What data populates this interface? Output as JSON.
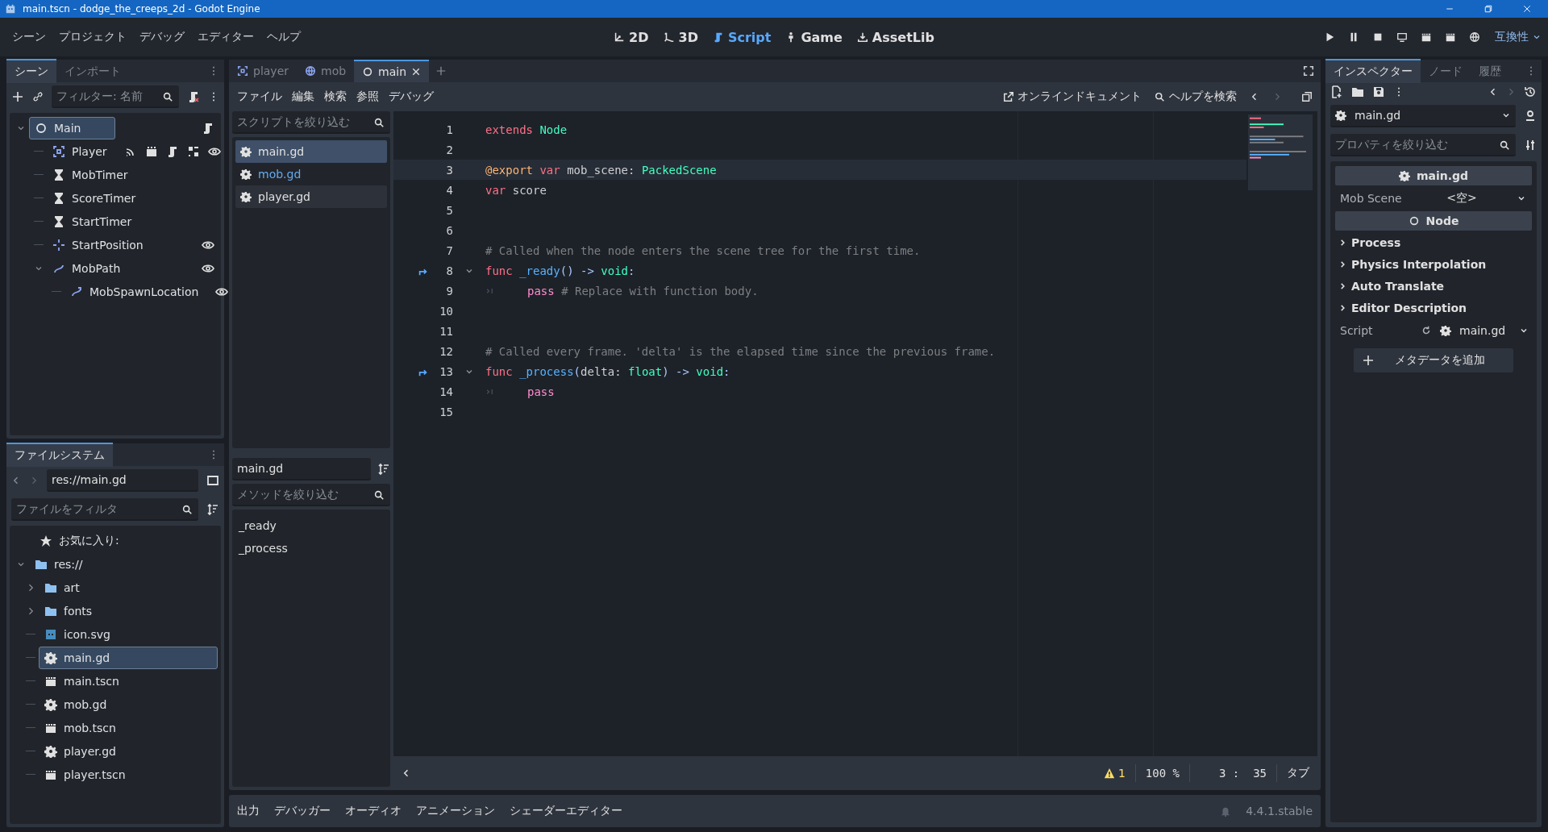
{
  "window": {
    "title": "main.tscn - dodge_the_creeps_2d - Godot Engine"
  },
  "menu": [
    "シーン",
    "プロジェクト",
    "デバッグ",
    "エディター",
    "ヘルプ"
  ],
  "workspaces": [
    {
      "label": "2D",
      "kind": "planar",
      "selected": false
    },
    {
      "label": "3D",
      "kind": "spatial",
      "selected": false
    },
    {
      "label": "Script",
      "kind": "script",
      "selected": true
    },
    {
      "label": "Game",
      "kind": "game",
      "selected": false
    },
    {
      "label": "AssetLib",
      "kind": "assetlib",
      "selected": false
    }
  ],
  "renderer": "互換性",
  "scene_dock": {
    "tabs": [
      {
        "label": "シーン",
        "selected": true
      },
      {
        "label": "インポート",
        "selected": false
      }
    ],
    "filter": {
      "placeholder": "フィルター: 名前"
    },
    "tree": [
      {
        "name": "Main",
        "kind": "node",
        "selected": true,
        "expanded": true,
        "has_script": true,
        "children": [
          {
            "name": "Player",
            "kind": "area",
            "selected": false,
            "signals": true,
            "groups": true,
            "has_script": true,
            "canvas": true,
            "visible": true
          },
          {
            "name": "MobTimer",
            "kind": "timer",
            "selected": false
          },
          {
            "name": "ScoreTimer",
            "kind": "timer",
            "selected": false
          },
          {
            "name": "StartTimer",
            "kind": "timer",
            "selected": false
          },
          {
            "name": "StartPosition",
            "kind": "marker",
            "selected": false,
            "visible": true
          },
          {
            "name": "MobPath",
            "kind": "path",
            "selected": false,
            "expanded": true,
            "visible": true,
            "children": [
              {
                "name": "MobSpawnLocation",
                "kind": "pathfollow",
                "selected": false,
                "visible": true
              }
            ]
          }
        ]
      }
    ]
  },
  "filesystem": {
    "tabs": [
      {
        "label": "ファイルシステム",
        "selected": true
      }
    ],
    "path": "res://main.gd",
    "filter": {
      "placeholder": "ファイルをフィルタ"
    },
    "favorites": "お気に入り:",
    "tree": [
      {
        "name": "res://",
        "kind": "folder",
        "selected": false,
        "expanded": true,
        "children": [
          {
            "name": "art",
            "kind": "folder",
            "selected": false,
            "expanded": false
          },
          {
            "name": "fonts",
            "kind": "folder",
            "selected": false,
            "expanded": false
          },
          {
            "name": "icon.svg",
            "kind": "image",
            "selected": false
          },
          {
            "name": "main.gd",
            "kind": "script",
            "selected": true
          },
          {
            "name": "main.tscn",
            "kind": "scene",
            "selected": false
          },
          {
            "name": "mob.gd",
            "kind": "script",
            "selected": false
          },
          {
            "name": "mob.tscn",
            "kind": "scene",
            "selected": false
          },
          {
            "name": "player.gd",
            "kind": "script",
            "selected": false
          },
          {
            "name": "player.tscn",
            "kind": "scene",
            "selected": false
          }
        ]
      }
    ]
  },
  "editor_tabs": [
    {
      "label": "player",
      "kind": "area",
      "selected": false
    },
    {
      "label": "mob",
      "kind": "globe",
      "selected": false
    },
    {
      "label": "main",
      "kind": "node",
      "selected": true
    }
  ],
  "script_menu": [
    "ファイル",
    "編集",
    "検索",
    "参照",
    "デバッグ"
  ],
  "script_links": [
    {
      "label": "オンラインドキュメント",
      "kind": "external"
    },
    {
      "label": "ヘルプを検索",
      "kind": "help"
    }
  ],
  "scripts": {
    "filter": {
      "placeholder": "スクリプトを絞り込む"
    },
    "items": [
      {
        "name": "main.gd",
        "selected": true,
        "in_scene": false,
        "hovered": false
      },
      {
        "name": "mob.gd",
        "selected": false,
        "in_scene": true,
        "hovered": false
      },
      {
        "name": "player.gd",
        "selected": false,
        "in_scene": false,
        "hovered": true
      }
    ],
    "current": "main.gd",
    "method_filter": {
      "placeholder": "メソッドを絞り込む"
    },
    "methods": [
      "_ready",
      "_process"
    ]
  },
  "code": [
    {
      "number": "1",
      "current": false,
      "foldable": false,
      "connected": false,
      "indented": false,
      "tokens": [
        {
          "kind": "kw",
          "text": "extends "
        },
        {
          "kind": "type",
          "text": "Node"
        }
      ]
    },
    {
      "number": "2",
      "current": false,
      "foldable": false,
      "connected": false,
      "indented": false
    },
    {
      "number": "3",
      "current": true,
      "foldable": false,
      "connected": false,
      "indented": false,
      "tokens": [
        {
          "kind": "anno",
          "text": "@export "
        },
        {
          "kind": "kw",
          "text": "var "
        },
        {
          "kind": "plain",
          "text": "mob_scene: "
        },
        {
          "kind": "type",
          "text": "PackedScene"
        }
      ]
    },
    {
      "number": "4",
      "current": false,
      "foldable": false,
      "connected": false,
      "indented": false,
      "tokens": [
        {
          "kind": "kw",
          "text": "var "
        },
        {
          "kind": "plain",
          "text": "score"
        }
      ]
    },
    {
      "number": "5",
      "current": false,
      "foldable": false,
      "connected": false,
      "indented": false
    },
    {
      "number": "6",
      "current": false,
      "foldable": false,
      "connected": false,
      "indented": false
    },
    {
      "number": "7",
      "current": false,
      "foldable": false,
      "connected": false,
      "indented": false,
      "tokens": [
        {
          "kind": "comment",
          "text": "# Called when the node enters the scene tree for the first time."
        }
      ]
    },
    {
      "number": "8",
      "current": false,
      "foldable": true,
      "connected": true,
      "indented": false,
      "tokens": [
        {
          "kind": "kw",
          "text": "func "
        },
        {
          "kind": "func",
          "text": "_ready"
        },
        {
          "kind": "sym",
          "text": "() -> "
        },
        {
          "kind": "type",
          "text": "void"
        },
        {
          "kind": "sym",
          "text": ":"
        }
      ]
    },
    {
      "number": "9",
      "current": false,
      "foldable": false,
      "connected": false,
      "indented": true,
      "tokens": [
        {
          "kind": "ctrl",
          "text": "pass "
        },
        {
          "kind": "comment",
          "text": "# Replace with function body."
        }
      ]
    },
    {
      "number": "10",
      "current": false,
      "foldable": false,
      "connected": false,
      "indented": false
    },
    {
      "number": "11",
      "current": false,
      "foldable": false,
      "connected": false,
      "indented": false
    },
    {
      "number": "12",
      "current": false,
      "foldable": false,
      "connected": false,
      "indented": false,
      "tokens": [
        {
          "kind": "comment",
          "text": "# Called every frame. 'delta' is the elapsed time since the previous frame."
        }
      ]
    },
    {
      "number": "13",
      "current": false,
      "foldable": true,
      "connected": true,
      "indented": false,
      "tokens": [
        {
          "kind": "kw",
          "text": "func "
        },
        {
          "kind": "func",
          "text": "_process"
        },
        {
          "kind": "sym",
          "text": "("
        },
        {
          "kind": "plain",
          "text": "delta: "
        },
        {
          "kind": "type",
          "text": "float"
        },
        {
          "kind": "sym",
          "text": ") -> "
        },
        {
          "kind": "type",
          "text": "void"
        },
        {
          "kind": "sym",
          "text": ":"
        }
      ]
    },
    {
      "number": "14",
      "current": false,
      "foldable": false,
      "connected": false,
      "indented": true,
      "tokens": [
        {
          "kind": "ctrl",
          "text": "pass"
        }
      ]
    },
    {
      "number": "15",
      "current": false,
      "foldable": false,
      "connected": false,
      "indented": false
    }
  ],
  "code_status": {
    "warnings": "1",
    "zoom": "100 %",
    "position": "3 :  35",
    "indent": "タブ"
  },
  "bottom_tabs": [
    "出力",
    "デバッガー",
    "オーディオ",
    "アニメーション",
    "シェーダーエディター"
  ],
  "version": "4.4.1.stable",
  "inspector": {
    "tabs": [
      {
        "label": "インスペクター",
        "selected": true
      },
      {
        "label": "ノード",
        "selected": false
      },
      {
        "label": "履歴",
        "selected": false
      }
    ],
    "resource": "main.gd",
    "filter": {
      "placeholder": "プロパティを絞り込む"
    },
    "rows": [
      {
        "kind": "scripthead",
        "label": "main.gd"
      },
      {
        "kind": "property",
        "label": "Mob Scene",
        "value": "<空>"
      },
      {
        "kind": "nodehead",
        "label": "Node"
      },
      {
        "kind": "group",
        "label": "Process"
      },
      {
        "kind": "group",
        "label": "Physics Interpolation"
      },
      {
        "kind": "group",
        "label": "Auto Translate"
      },
      {
        "kind": "group",
        "label": "Editor Description"
      },
      {
        "kind": "script",
        "label": "Script",
        "value": "main.gd"
      }
    ],
    "add_button": "メタデータを追加"
  }
}
